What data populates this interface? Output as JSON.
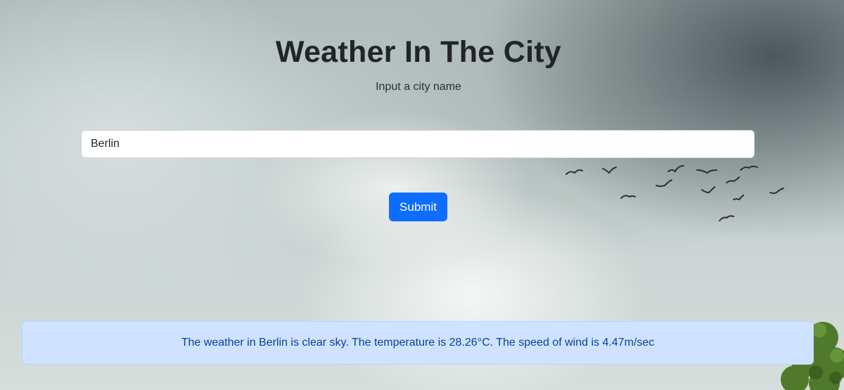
{
  "app": {
    "heading": "Weather In The City",
    "subheading": "Input a city name"
  },
  "form": {
    "city_value": "Berlin",
    "submit_label": "Submit"
  },
  "result": {
    "message": "The weather in Berlin is clear sky. The temperature is 28.26°C. The speed of wind is 4.47m/sec"
  },
  "colors": {
    "primary_button": "#0d6efd",
    "alert_background": "#cfe2ff",
    "alert_text": "#084298",
    "heading_text": "#212529"
  },
  "icons": {
    "background": "cloudy-sky-background",
    "birds": "flying-birds",
    "tree": "tree-foliage"
  }
}
